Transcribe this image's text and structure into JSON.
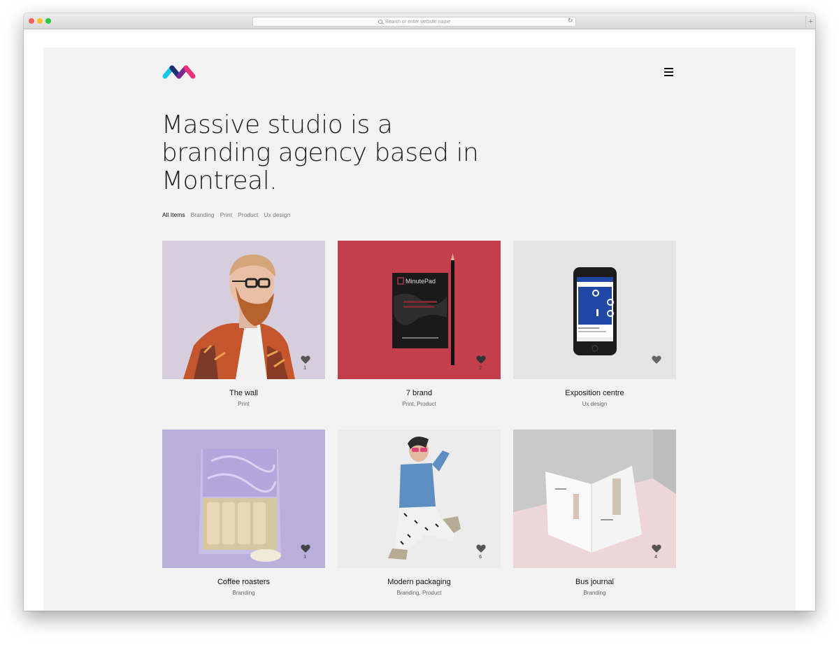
{
  "browser": {
    "url_placeholder": "Search or enter website name",
    "new_tab_label": "+"
  },
  "site": {
    "headline": "Massive studio is a branding agency based in Montreal.",
    "filters": [
      {
        "label": "All Items",
        "active": true
      },
      {
        "label": "Branding",
        "active": false
      },
      {
        "label": "Print",
        "active": false
      },
      {
        "label": "Product",
        "active": false
      },
      {
        "label": "Ux design",
        "active": false
      }
    ]
  },
  "projects": [
    {
      "title": "The wall",
      "category": "Print",
      "likes": "1",
      "image": "bearded man with glasses in plaid blazer"
    },
    {
      "title": "7 brand",
      "category": "Print, Product",
      "likes": "2",
      "image": "black MinutePad notebook with pencil on red"
    },
    {
      "title": "Exposition centre",
      "category": "Ux design",
      "likes": "",
      "image": "smartphone showing blue app"
    },
    {
      "title": "Coffee roasters",
      "category": "Branding",
      "likes": "1",
      "image": "coffee packaging bag on lavender"
    },
    {
      "title": "Modern packaging",
      "category": "Branding, Product",
      "likes": "6",
      "image": "woman in denim shirt sitting"
    },
    {
      "title": "Bus journal",
      "category": "Branding",
      "likes": "4",
      "image": "open magazine on pink floor"
    }
  ],
  "notebook_brand": "MinutePad",
  "colors": {
    "page_bg": "#f3f3f3",
    "logo_cyan": "#18c7e8",
    "logo_navy": "#1f2e6e",
    "logo_pink": "#e8327c",
    "notebook_bg": "#c43f4d",
    "app_blue": "#2147a5"
  },
  "icons": [
    "logo-icon",
    "menu-icon",
    "heart-icon",
    "search-icon",
    "reload-icon"
  ]
}
